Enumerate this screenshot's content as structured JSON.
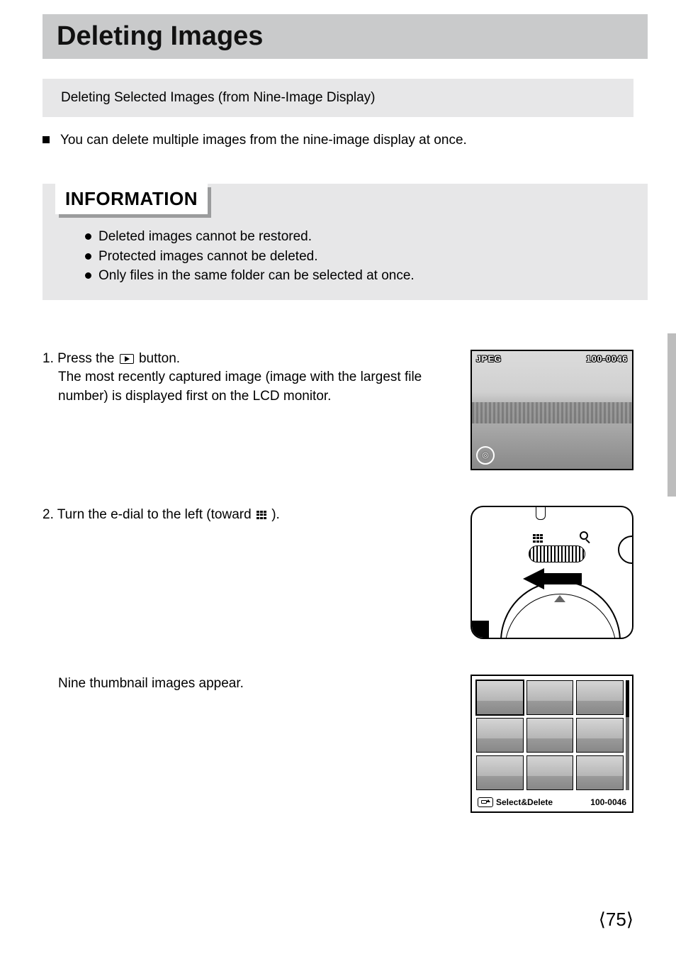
{
  "title": "Deleting Images",
  "subtitle": "Deleting Selected Images (from Nine-Image Display)",
  "intro": "You can delete multiple images from the nine-image display at once.",
  "info_heading": "INFORMATION",
  "info_items": [
    "Deleted images cannot be restored.",
    "Protected images cannot be deleted.",
    "Only files in the same folder can be selected at once."
  ],
  "steps": {
    "s1": {
      "num": "1. Press the ",
      "after_icon": " button.",
      "detail": "The most recently captured image (image with the largest file number) is displayed first on the LCD monitor."
    },
    "s2": {
      "num": "2. Turn the e-dial to the left (toward ",
      "after_icon": ")."
    },
    "s2b": {
      "text": "Nine thumbnail images appear."
    }
  },
  "lcd": {
    "format": "JPEG",
    "file_no": "100-0046"
  },
  "nine": {
    "action": "Select&Delete",
    "file_no": "100-0046"
  },
  "page_number": "75"
}
